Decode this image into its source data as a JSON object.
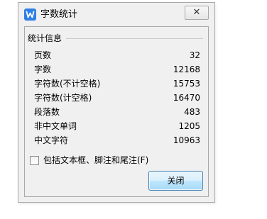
{
  "window": {
    "title": "字数统计",
    "close_label": "✕"
  },
  "group": {
    "legend": "统计信息"
  },
  "stats": [
    {
      "label": "页数",
      "value": "32"
    },
    {
      "label": "字数",
      "value": "12168"
    },
    {
      "label": "字符数(不计空格)",
      "value": "15753"
    },
    {
      "label": "字符数(计空格)",
      "value": "16470"
    },
    {
      "label": "段落数",
      "value": "483"
    },
    {
      "label": "非中文单词",
      "value": "1205"
    },
    {
      "label": "中文字符",
      "value": "10963"
    }
  ],
  "options": {
    "include_textboxes_label": "包括文本框、脚注和尾注(F)",
    "include_textboxes_checked": false
  },
  "buttons": {
    "close_label": "关闭"
  },
  "colors": {
    "accent": "#2f7fe5",
    "button_border": "#3c7fb1",
    "dialog_bg": "#f0f0f0"
  },
  "icons": {
    "app": "wps-writer-icon",
    "close": "close-icon"
  }
}
